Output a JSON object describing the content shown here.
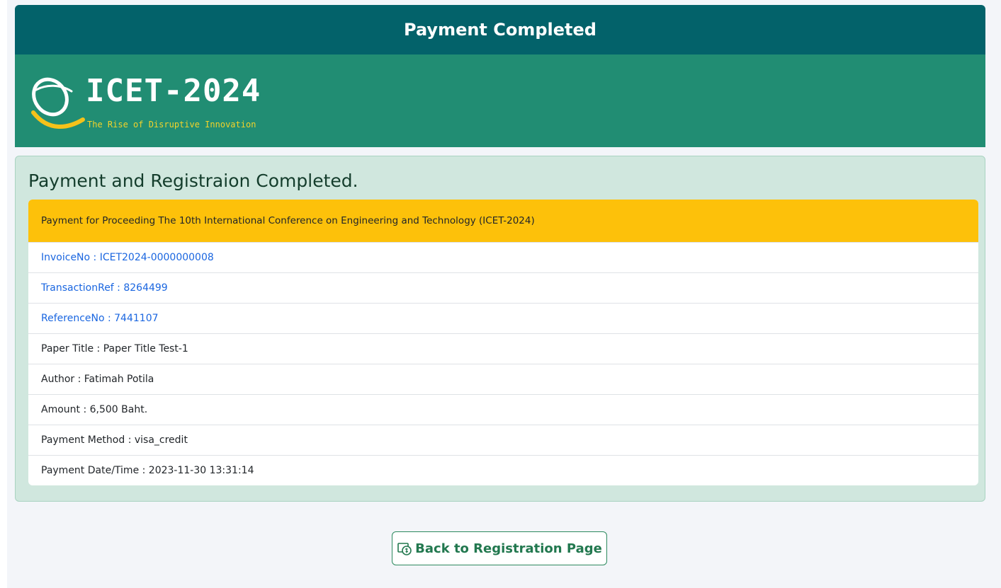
{
  "header": {
    "title": "Payment Completed"
  },
  "banner": {
    "logo_text": "ICET-2024",
    "tagline": "The Rise of Disruptive Innovation"
  },
  "card": {
    "title": "Payment and Registraion Completed.",
    "list_header": "Payment for Proceeding The 10th International Conference on Engineering and Technology (ICET-2024)",
    "rows": [
      "InvoiceNo : ICET2024-0000000008",
      "TransactionRef : 8264499",
      "ReferenceNo : 7441107",
      "Paper Title : Paper Title Test-1",
      "Author : Fatimah Potila",
      "Amount : 6,500 Baht.",
      "Payment Method : visa_credit",
      "Payment Date/Time : 2023-11-30 13:31:14"
    ]
  },
  "actions": {
    "back_label": "Back to Registration Page",
    "back_icon": "cash-receipt-icon"
  },
  "colors": {
    "header_bg": "#03626a",
    "banner_bg": "#218d73",
    "card_bg": "#d0e7de",
    "list_header_bg": "#fdc10a",
    "link": "#1a66e0",
    "button": "#22784f"
  }
}
